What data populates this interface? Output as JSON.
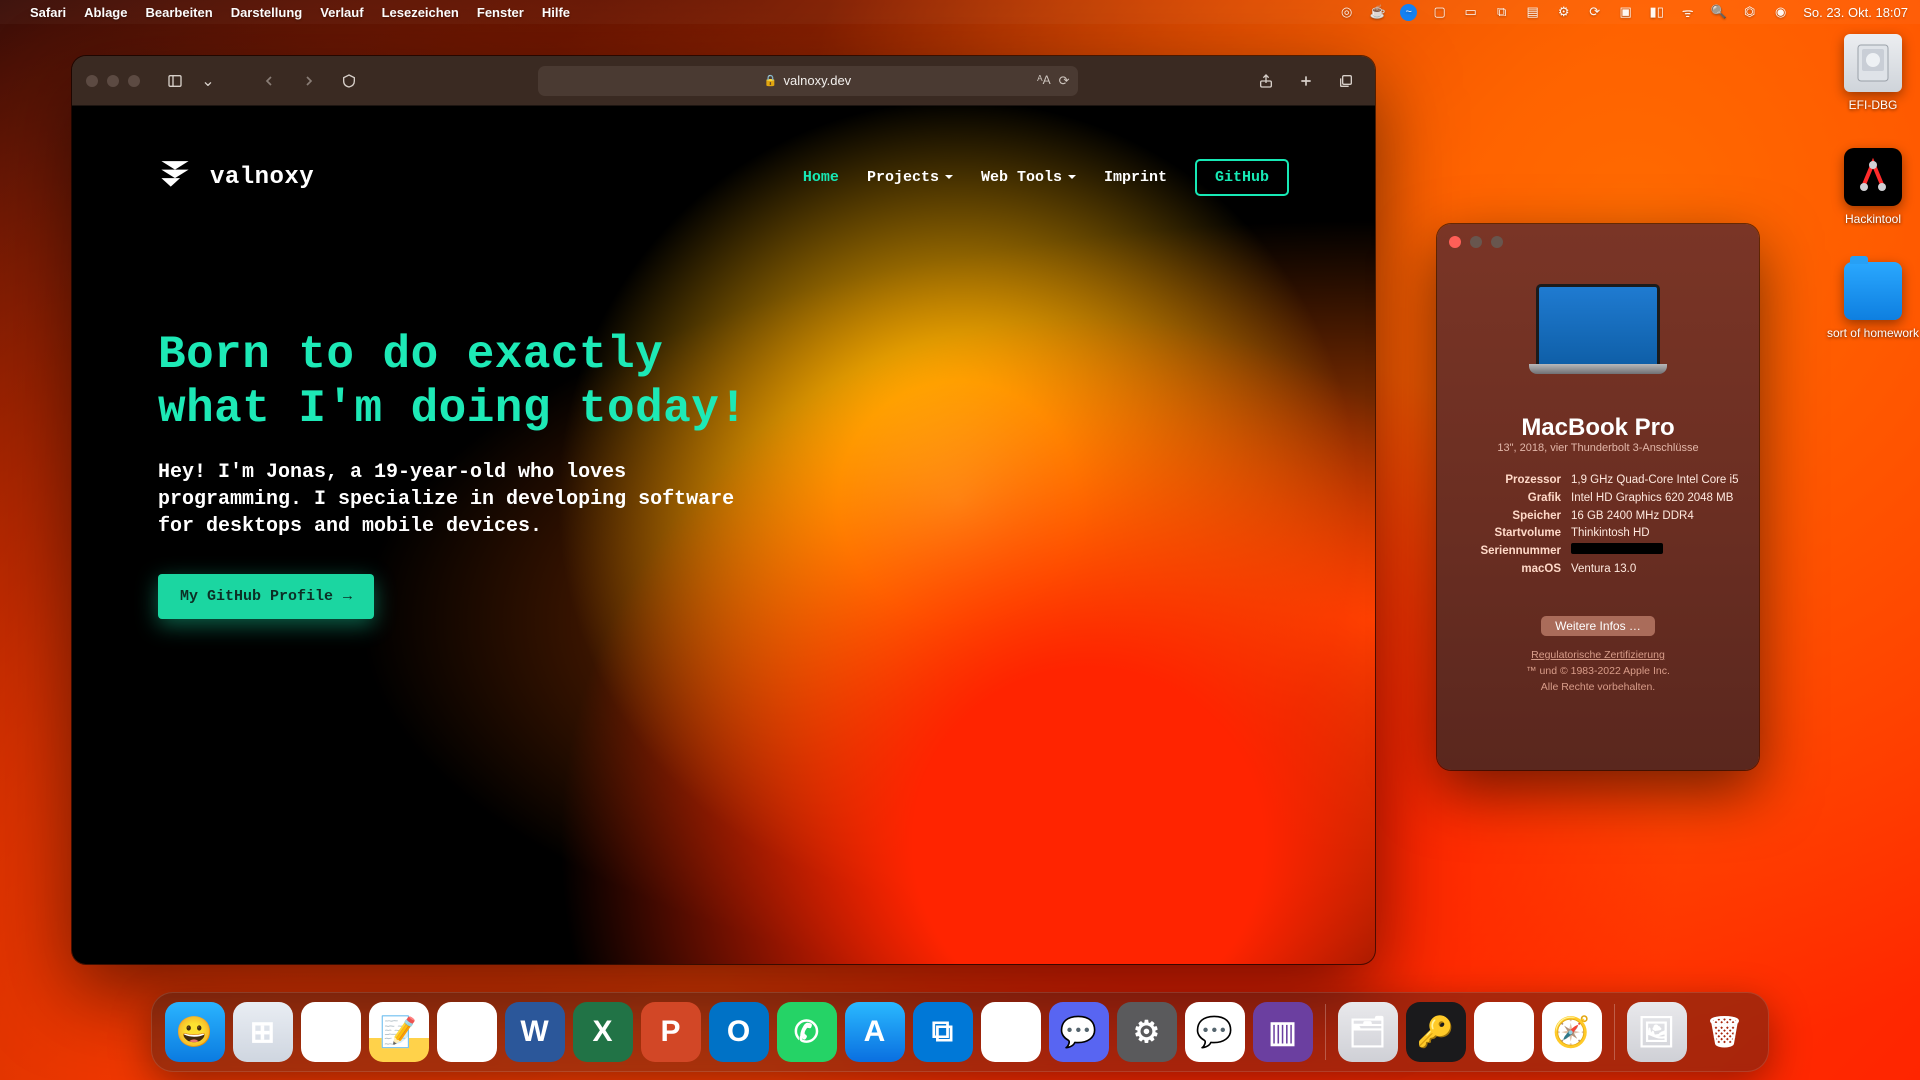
{
  "menubar": {
    "app": "Safari",
    "items": [
      "Ablage",
      "Bearbeiten",
      "Darstellung",
      "Verlauf",
      "Lesezeichen",
      "Fenster",
      "Hilfe"
    ],
    "clock": "So. 23. Okt.  18:07"
  },
  "safari": {
    "url_display": "valnoxy.dev",
    "site": {
      "brand": "valnoxy",
      "nav": {
        "home": "Home",
        "projects": "Projects",
        "webtools": "Web Tools",
        "imprint": "Imprint",
        "github": "GitHub"
      },
      "hero_title": "Born to do exactly what I'm doing today!",
      "hero_body": "Hey! I'm Jonas, a 19-year-old who loves programming. I specialize in developing software for desktops and mobile devices.",
      "cta": "My GitHub Profile"
    }
  },
  "about": {
    "model": "MacBook Pro",
    "sub": "13\", 2018, vier Thunderbolt 3-Anschlüsse",
    "labels": {
      "cpu": "Prozessor",
      "gpu": "Grafik",
      "mem": "Speicher",
      "start": "Startvolume",
      "serial": "Seriennummer",
      "os": "macOS"
    },
    "cpu": "1,9 GHz Quad-Core Intel Core i5",
    "gpu": "Intel HD Graphics 620 2048 MB",
    "mem": "16 GB 2400 MHz DDR4",
    "start": "Thinkintosh HD",
    "os": "Ventura 13.0",
    "more": "Weitere Infos …",
    "cert": "Regulatorische Zertifizierung",
    "copyright": "™ und © 1983-2022 Apple Inc.",
    "rights": "Alle Rechte vorbehalten."
  },
  "desktop": {
    "efi": "EFI-DBG",
    "hack": "Hackintool",
    "fold": "sort of homework"
  },
  "dock": [
    {
      "n": "finder",
      "bg": "linear-gradient(#2ab4ff,#0b7be0)",
      "g": "😀"
    },
    {
      "n": "launchpad",
      "bg": "linear-gradient(#e9edf3,#cfd6e0)",
      "g": "⊞"
    },
    {
      "n": "chrome",
      "bg": "#fff",
      "g": "◉"
    },
    {
      "n": "notes",
      "bg": "linear-gradient(#fff,#fff 60%,#ffd24a 60%)",
      "g": "📝"
    },
    {
      "n": "photos",
      "bg": "#fff",
      "g": "❋"
    },
    {
      "n": "word",
      "bg": "#2b579a",
      "g": "W"
    },
    {
      "n": "excel",
      "bg": "#217346",
      "g": "X"
    },
    {
      "n": "powerpoint",
      "bg": "#d24726",
      "g": "P"
    },
    {
      "n": "outlook",
      "bg": "#0072c6",
      "g": "O"
    },
    {
      "n": "whatsapp",
      "bg": "#25d366",
      "g": "✆"
    },
    {
      "n": "appstore",
      "bg": "linear-gradient(#2ab9ff,#0a6fe0)",
      "g": "A"
    },
    {
      "n": "vscode",
      "bg": "#0078d7",
      "g": "⧉"
    },
    {
      "n": "visualstudio",
      "bg": "#fff",
      "g": "∞"
    },
    {
      "n": "discord",
      "bg": "#5865f2",
      "g": "💬"
    },
    {
      "n": "settings",
      "bg": "#5a5a5c",
      "g": "⚙"
    },
    {
      "n": "messages",
      "bg": "#fff",
      "g": "💬"
    },
    {
      "n": "jetbrains",
      "bg": "#6b3fa0",
      "g": "▥"
    },
    {
      "n": "sep"
    },
    {
      "n": "folder1",
      "bg": "linear-gradient(#e9e9ec,#cfd0d6)",
      "g": "🗂"
    },
    {
      "n": "1password",
      "bg": "#1a1a1c",
      "g": "🔑"
    },
    {
      "n": "teamviewer",
      "bg": "#fff",
      "g": "↔"
    },
    {
      "n": "safari",
      "bg": "#fff",
      "g": "🧭"
    },
    {
      "n": "sep"
    },
    {
      "n": "preview",
      "bg": "linear-gradient(#e9e9ec,#cfd0d6)",
      "g": "🖼"
    },
    {
      "n": "trash",
      "bg": "transparent",
      "g": "🗑"
    }
  ]
}
